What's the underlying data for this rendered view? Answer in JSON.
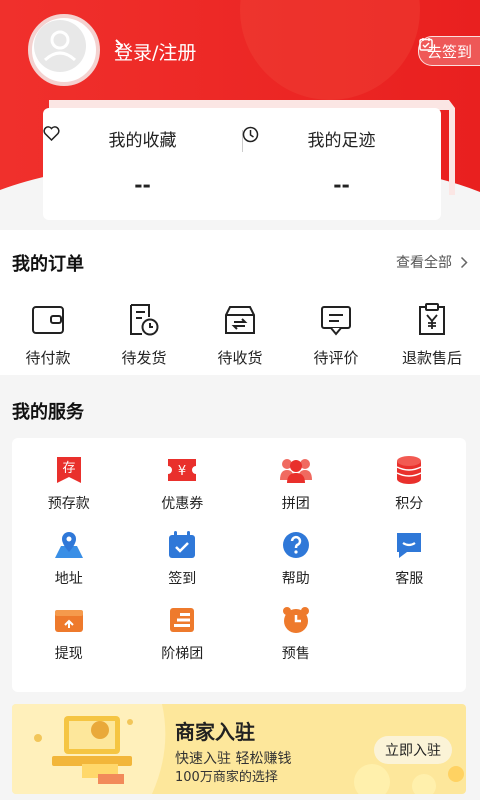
{
  "colors": {
    "brand_red": "#ee2a2a",
    "banner_yellow": "#fde79b"
  },
  "header": {
    "login_label": "登录/注册",
    "checkin_label": "去签到"
  },
  "favorites_card": {
    "collections_label": "我的收藏",
    "collections_value": "--",
    "footprints_label": "我的足迹",
    "footprints_value": "--"
  },
  "orders": {
    "title": "我的订单",
    "view_all": "查看全部",
    "items": [
      {
        "label": "待付款",
        "icon": "wallet-icon"
      },
      {
        "label": "待发货",
        "icon": "clock-document-icon"
      },
      {
        "label": "待收货",
        "icon": "delivery-box-icon"
      },
      {
        "label": "待评价",
        "icon": "comment-icon"
      },
      {
        "label": "退款售后",
        "icon": "refund-clipboard-icon"
      }
    ]
  },
  "services": {
    "title": "我的服务",
    "items": [
      {
        "label": "预存款",
        "icon": "deposit-icon"
      },
      {
        "label": "优惠券",
        "icon": "coupon-icon"
      },
      {
        "label": "拼团",
        "icon": "group-icon"
      },
      {
        "label": "积分",
        "icon": "points-coins-icon"
      },
      {
        "label": "地址",
        "icon": "map-pin-icon"
      },
      {
        "label": "签到",
        "icon": "calendar-check-icon"
      },
      {
        "label": "帮助",
        "icon": "help-icon"
      },
      {
        "label": "客服",
        "icon": "chat-service-icon"
      },
      {
        "label": "提现",
        "icon": "withdraw-wallet-icon"
      },
      {
        "label": "阶梯团",
        "icon": "ladder-icon"
      },
      {
        "label": "预售",
        "icon": "alarm-clock-icon"
      }
    ]
  },
  "banner": {
    "title": "商家入驻",
    "subtitle": "快速入驻  轻松赚钱",
    "tagline": "100万商家的选择",
    "button": "立即入驻"
  }
}
